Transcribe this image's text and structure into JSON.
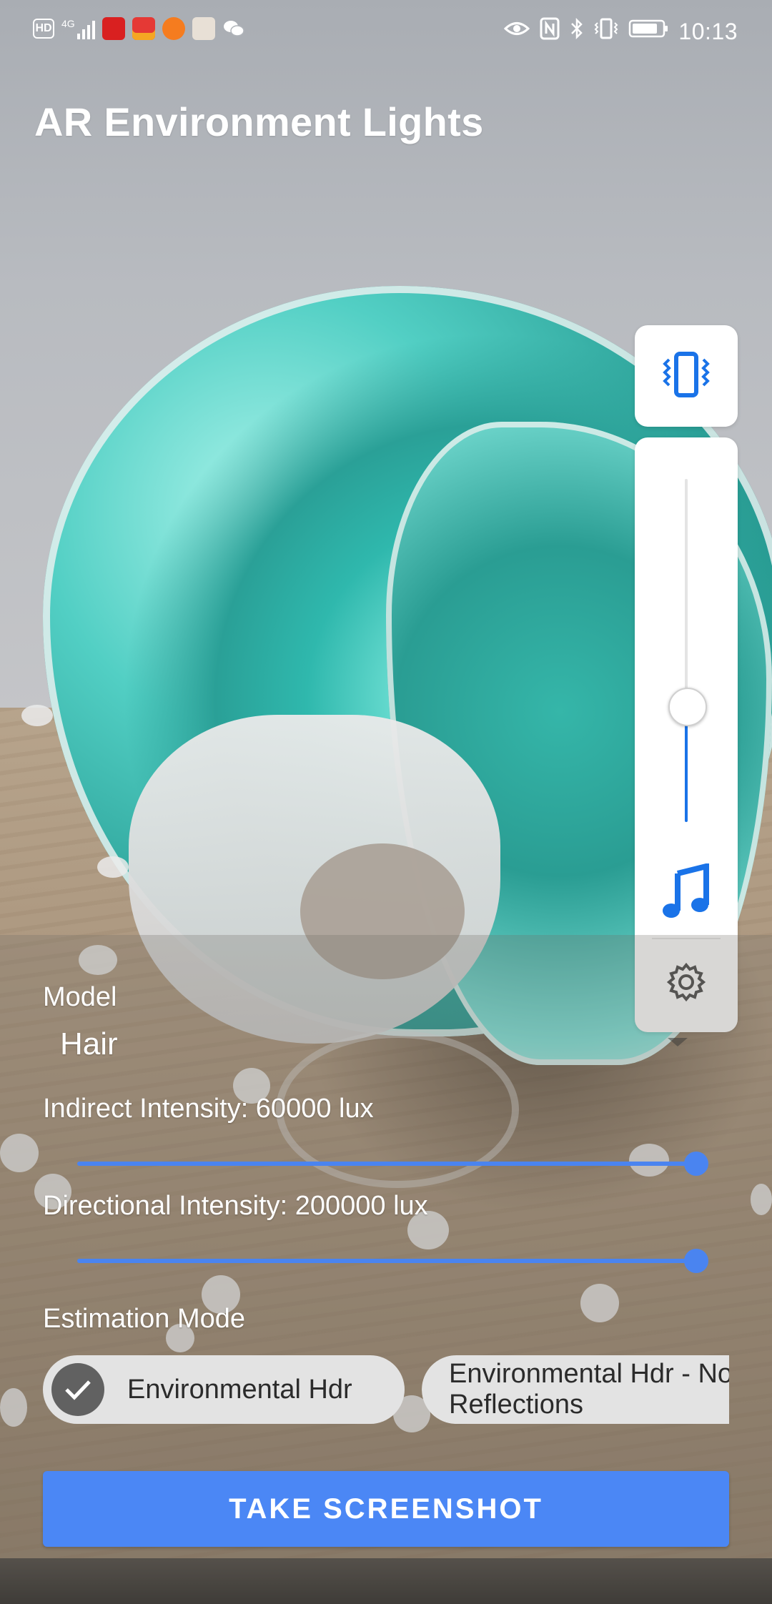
{
  "status_bar": {
    "network_label": "HD",
    "network_type": "4G",
    "time": "10:13",
    "icons_left": [
      "hd-icon",
      "signal-icon",
      "video-app-icon",
      "slides-app-icon",
      "play-app-icon",
      "box-app-icon",
      "wechat-icon"
    ],
    "icons_right": [
      "eye-icon",
      "nfc-icon",
      "bluetooth-icon",
      "vibrate-icon",
      "battery-icon"
    ]
  },
  "app": {
    "title": "AR Environment Lights"
  },
  "volume_panel": {
    "level": 0.34,
    "mode_icon": "vibrate-icon",
    "stream_icon": "music-note-icon",
    "settings_icon": "gear-icon",
    "accent_color": "#1a73e8"
  },
  "controls": {
    "model_label": "Model",
    "model_value": "Hair",
    "indirect_label": "Indirect Intensity: 60000 lux",
    "indirect_level": 1.0,
    "directional_label": "Directional Intensity: 200000 lux",
    "directional_level": 1.0,
    "estimation_label": "Estimation Mode",
    "mode_options": [
      {
        "label": "Environmental Hdr",
        "selected": true
      },
      {
        "label": "Environmental Hdr - No Reflections",
        "selected": false
      }
    ],
    "screenshot_button": "TAKE SCREENSHOT",
    "accent_color": "#4b87f5"
  }
}
